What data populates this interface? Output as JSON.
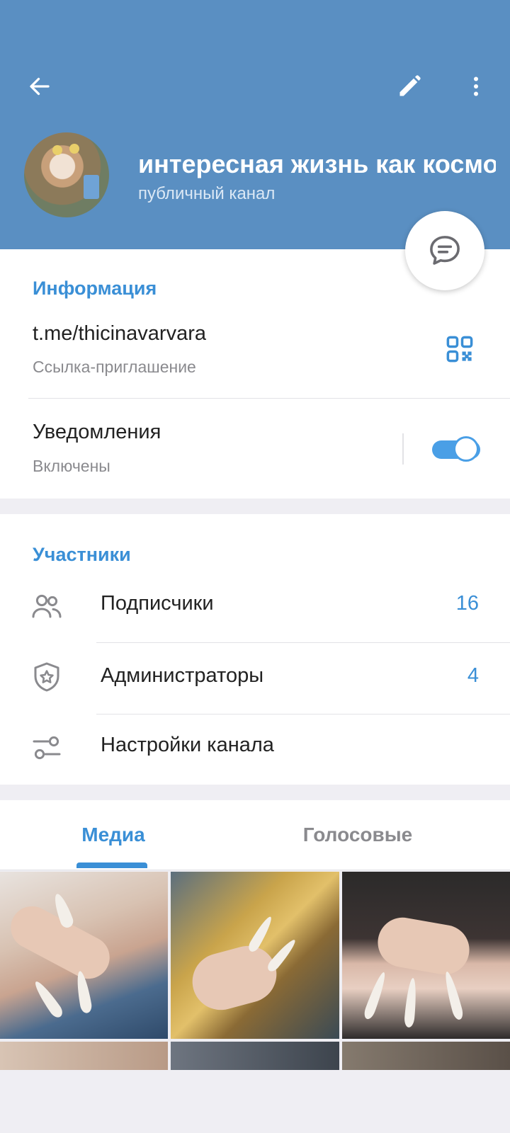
{
  "header": {
    "back_icon": "arrow-left-icon",
    "edit_icon": "pencil-icon",
    "menu_icon": "more-vertical-icon",
    "title": "интересная жизнь как космос",
    "subtitle": "публичный канал",
    "fab_icon": "chat-bubble-icon"
  },
  "info": {
    "section_title": "Информация",
    "link": "t.me/thicinavarvara",
    "link_caption": "Ссылка-приглашение",
    "qr_icon": "qr-code-icon",
    "notifications_label": "Уведомления",
    "notifications_status": "Включены",
    "notifications_enabled": true
  },
  "members": {
    "section_title": "Участники",
    "rows": [
      {
        "label": "Подписчики",
        "count": "16",
        "icon": "people-icon"
      },
      {
        "label": "Администраторы",
        "count": "4",
        "icon": "shield-star-icon"
      },
      {
        "label": "Настройки канала",
        "count": "",
        "icon": "sliders-icon"
      }
    ]
  },
  "tabs": {
    "items": [
      {
        "label": "Медиа",
        "active": true
      },
      {
        "label": "Голосовые",
        "active": false
      }
    ]
  },
  "colors": {
    "header_bg": "#5a8fc2",
    "accent": "#3a8fd6",
    "toggle_on": "#4a9fe6"
  }
}
